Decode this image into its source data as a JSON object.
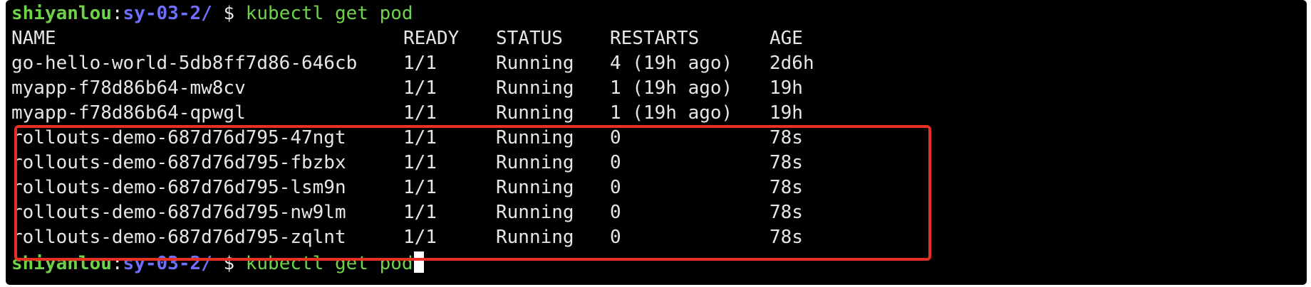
{
  "prompt": {
    "user": "shiyanlou",
    "colon": ":",
    "path": "sy-03-2/",
    "dollar": "$",
    "command": "kubectl get pod"
  },
  "table": {
    "headers": [
      "NAME",
      "READY",
      "STATUS",
      "RESTARTS",
      "AGE"
    ],
    "rows": [
      [
        "go-hello-world-5db8ff7d86-646cb",
        "1/1",
        "Running",
        "4 (19h ago)",
        "2d6h"
      ],
      [
        "myapp-f78d86b64-mw8cv",
        "1/1",
        "Running",
        "1 (19h ago)",
        "19h"
      ],
      [
        "myapp-f78d86b64-qpwgl",
        "1/1",
        "Running",
        "1 (19h ago)",
        "19h"
      ],
      [
        "rollouts-demo-687d76d795-47ngt",
        "1/1",
        "Running",
        "0",
        "78s"
      ],
      [
        "rollouts-demo-687d76d795-fbzbx",
        "1/1",
        "Running",
        "0",
        "78s"
      ],
      [
        "rollouts-demo-687d76d795-lsm9n",
        "1/1",
        "Running",
        "0",
        "78s"
      ],
      [
        "rollouts-demo-687d76d795-nw9lm",
        "1/1",
        "Running",
        "0",
        "78s"
      ],
      [
        "rollouts-demo-687d76d795-zqlnt",
        "1/1",
        "Running",
        "0",
        "78s"
      ]
    ]
  },
  "colors": {
    "background": "#000000",
    "text": "#e6e6e6",
    "prompt_user": "#6fd34a",
    "prompt_path": "#6f6fff",
    "highlight": "#e53022"
  }
}
